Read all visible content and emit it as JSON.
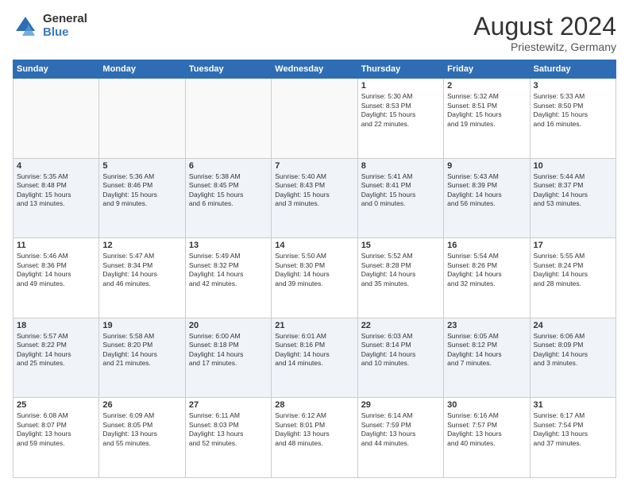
{
  "logo": {
    "general": "General",
    "blue": "Blue"
  },
  "title": "August 2024",
  "location": "Priestewitz, Germany",
  "days_header": [
    "Sunday",
    "Monday",
    "Tuesday",
    "Wednesday",
    "Thursday",
    "Friday",
    "Saturday"
  ],
  "weeks": [
    [
      {
        "day": "",
        "info": ""
      },
      {
        "day": "",
        "info": ""
      },
      {
        "day": "",
        "info": ""
      },
      {
        "day": "",
        "info": ""
      },
      {
        "day": "1",
        "info": "Sunrise: 5:30 AM\nSunset: 8:53 PM\nDaylight: 15 hours\nand 22 minutes."
      },
      {
        "day": "2",
        "info": "Sunrise: 5:32 AM\nSunset: 8:51 PM\nDaylight: 15 hours\nand 19 minutes."
      },
      {
        "day": "3",
        "info": "Sunrise: 5:33 AM\nSunset: 8:50 PM\nDaylight: 15 hours\nand 16 minutes."
      }
    ],
    [
      {
        "day": "4",
        "info": "Sunrise: 5:35 AM\nSunset: 8:48 PM\nDaylight: 15 hours\nand 13 minutes."
      },
      {
        "day": "5",
        "info": "Sunrise: 5:36 AM\nSunset: 8:46 PM\nDaylight: 15 hours\nand 9 minutes."
      },
      {
        "day": "6",
        "info": "Sunrise: 5:38 AM\nSunset: 8:45 PM\nDaylight: 15 hours\nand 6 minutes."
      },
      {
        "day": "7",
        "info": "Sunrise: 5:40 AM\nSunset: 8:43 PM\nDaylight: 15 hours\nand 3 minutes."
      },
      {
        "day": "8",
        "info": "Sunrise: 5:41 AM\nSunset: 8:41 PM\nDaylight: 15 hours\nand 0 minutes."
      },
      {
        "day": "9",
        "info": "Sunrise: 5:43 AM\nSunset: 8:39 PM\nDaylight: 14 hours\nand 56 minutes."
      },
      {
        "day": "10",
        "info": "Sunrise: 5:44 AM\nSunset: 8:37 PM\nDaylight: 14 hours\nand 53 minutes."
      }
    ],
    [
      {
        "day": "11",
        "info": "Sunrise: 5:46 AM\nSunset: 8:36 PM\nDaylight: 14 hours\nand 49 minutes."
      },
      {
        "day": "12",
        "info": "Sunrise: 5:47 AM\nSunset: 8:34 PM\nDaylight: 14 hours\nand 46 minutes."
      },
      {
        "day": "13",
        "info": "Sunrise: 5:49 AM\nSunset: 8:32 PM\nDaylight: 14 hours\nand 42 minutes."
      },
      {
        "day": "14",
        "info": "Sunrise: 5:50 AM\nSunset: 8:30 PM\nDaylight: 14 hours\nand 39 minutes."
      },
      {
        "day": "15",
        "info": "Sunrise: 5:52 AM\nSunset: 8:28 PM\nDaylight: 14 hours\nand 35 minutes."
      },
      {
        "day": "16",
        "info": "Sunrise: 5:54 AM\nSunset: 8:26 PM\nDaylight: 14 hours\nand 32 minutes."
      },
      {
        "day": "17",
        "info": "Sunrise: 5:55 AM\nSunset: 8:24 PM\nDaylight: 14 hours\nand 28 minutes."
      }
    ],
    [
      {
        "day": "18",
        "info": "Sunrise: 5:57 AM\nSunset: 8:22 PM\nDaylight: 14 hours\nand 25 minutes."
      },
      {
        "day": "19",
        "info": "Sunrise: 5:58 AM\nSunset: 8:20 PM\nDaylight: 14 hours\nand 21 minutes."
      },
      {
        "day": "20",
        "info": "Sunrise: 6:00 AM\nSunset: 8:18 PM\nDaylight: 14 hours\nand 17 minutes."
      },
      {
        "day": "21",
        "info": "Sunrise: 6:01 AM\nSunset: 8:16 PM\nDaylight: 14 hours\nand 14 minutes."
      },
      {
        "day": "22",
        "info": "Sunrise: 6:03 AM\nSunset: 8:14 PM\nDaylight: 14 hours\nand 10 minutes."
      },
      {
        "day": "23",
        "info": "Sunrise: 6:05 AM\nSunset: 8:12 PM\nDaylight: 14 hours\nand 7 minutes."
      },
      {
        "day": "24",
        "info": "Sunrise: 6:06 AM\nSunset: 8:09 PM\nDaylight: 14 hours\nand 3 minutes."
      }
    ],
    [
      {
        "day": "25",
        "info": "Sunrise: 6:08 AM\nSunset: 8:07 PM\nDaylight: 13 hours\nand 59 minutes."
      },
      {
        "day": "26",
        "info": "Sunrise: 6:09 AM\nSunset: 8:05 PM\nDaylight: 13 hours\nand 55 minutes."
      },
      {
        "day": "27",
        "info": "Sunrise: 6:11 AM\nSunset: 8:03 PM\nDaylight: 13 hours\nand 52 minutes."
      },
      {
        "day": "28",
        "info": "Sunrise: 6:12 AM\nSunset: 8:01 PM\nDaylight: 13 hours\nand 48 minutes."
      },
      {
        "day": "29",
        "info": "Sunrise: 6:14 AM\nSunset: 7:59 PM\nDaylight: 13 hours\nand 44 minutes."
      },
      {
        "day": "30",
        "info": "Sunrise: 6:16 AM\nSunset: 7:57 PM\nDaylight: 13 hours\nand 40 minutes."
      },
      {
        "day": "31",
        "info": "Sunrise: 6:17 AM\nSunset: 7:54 PM\nDaylight: 13 hours\nand 37 minutes."
      }
    ]
  ]
}
